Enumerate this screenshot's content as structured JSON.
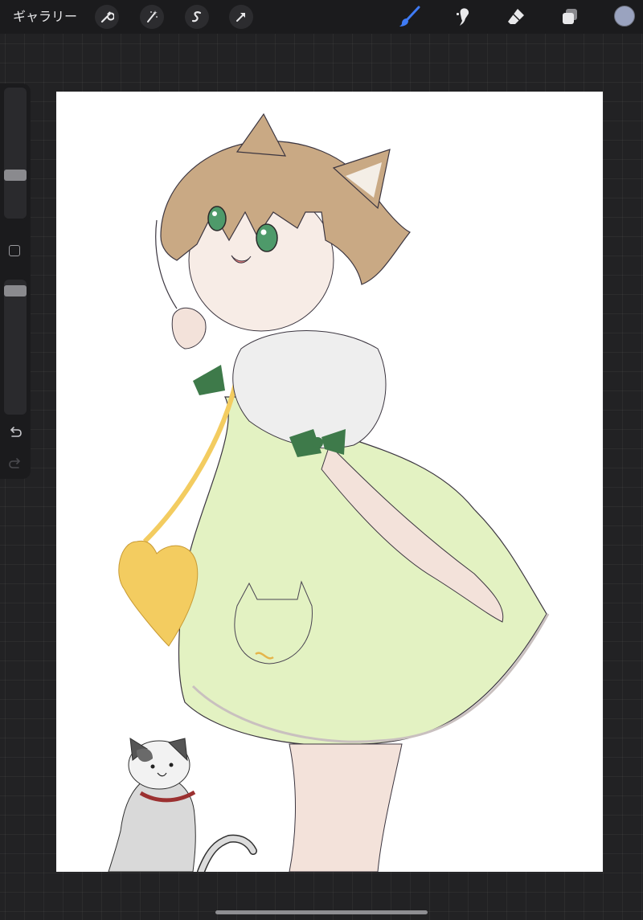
{
  "topbar": {
    "gallery_label": "ギャラリー",
    "left_tools": [
      {
        "name": "actions",
        "icon": "wrench-icon"
      },
      {
        "name": "adjustments",
        "icon": "magic-wand-icon"
      },
      {
        "name": "selection",
        "icon": "selection-s-icon"
      },
      {
        "name": "transform",
        "icon": "arrow-cursor-icon"
      }
    ],
    "right_tools": [
      {
        "name": "brush",
        "icon": "brush-icon",
        "active": true
      },
      {
        "name": "smudge",
        "icon": "smudge-icon",
        "active": false
      },
      {
        "name": "eraser",
        "icon": "eraser-icon",
        "active": false
      },
      {
        "name": "layers",
        "icon": "layers-icon",
        "active": false
      }
    ],
    "current_color": "#9aa3bf",
    "accent_color": "#3f7bf5"
  },
  "sidebar": {
    "brush_size_level": 0.65,
    "opacity_level": 0.95,
    "controls": [
      "brush-size-slider",
      "modifier-button",
      "opacity-slider",
      "undo",
      "redo"
    ]
  },
  "canvas": {
    "background": "#ffffff",
    "content": "illustration"
  },
  "colors": {
    "dress": "#e3f2c2",
    "hair": "#c9a984",
    "ribbon": "#3e7a4a",
    "bag": "#f3cc60",
    "eyes": "#4e9a6a"
  }
}
